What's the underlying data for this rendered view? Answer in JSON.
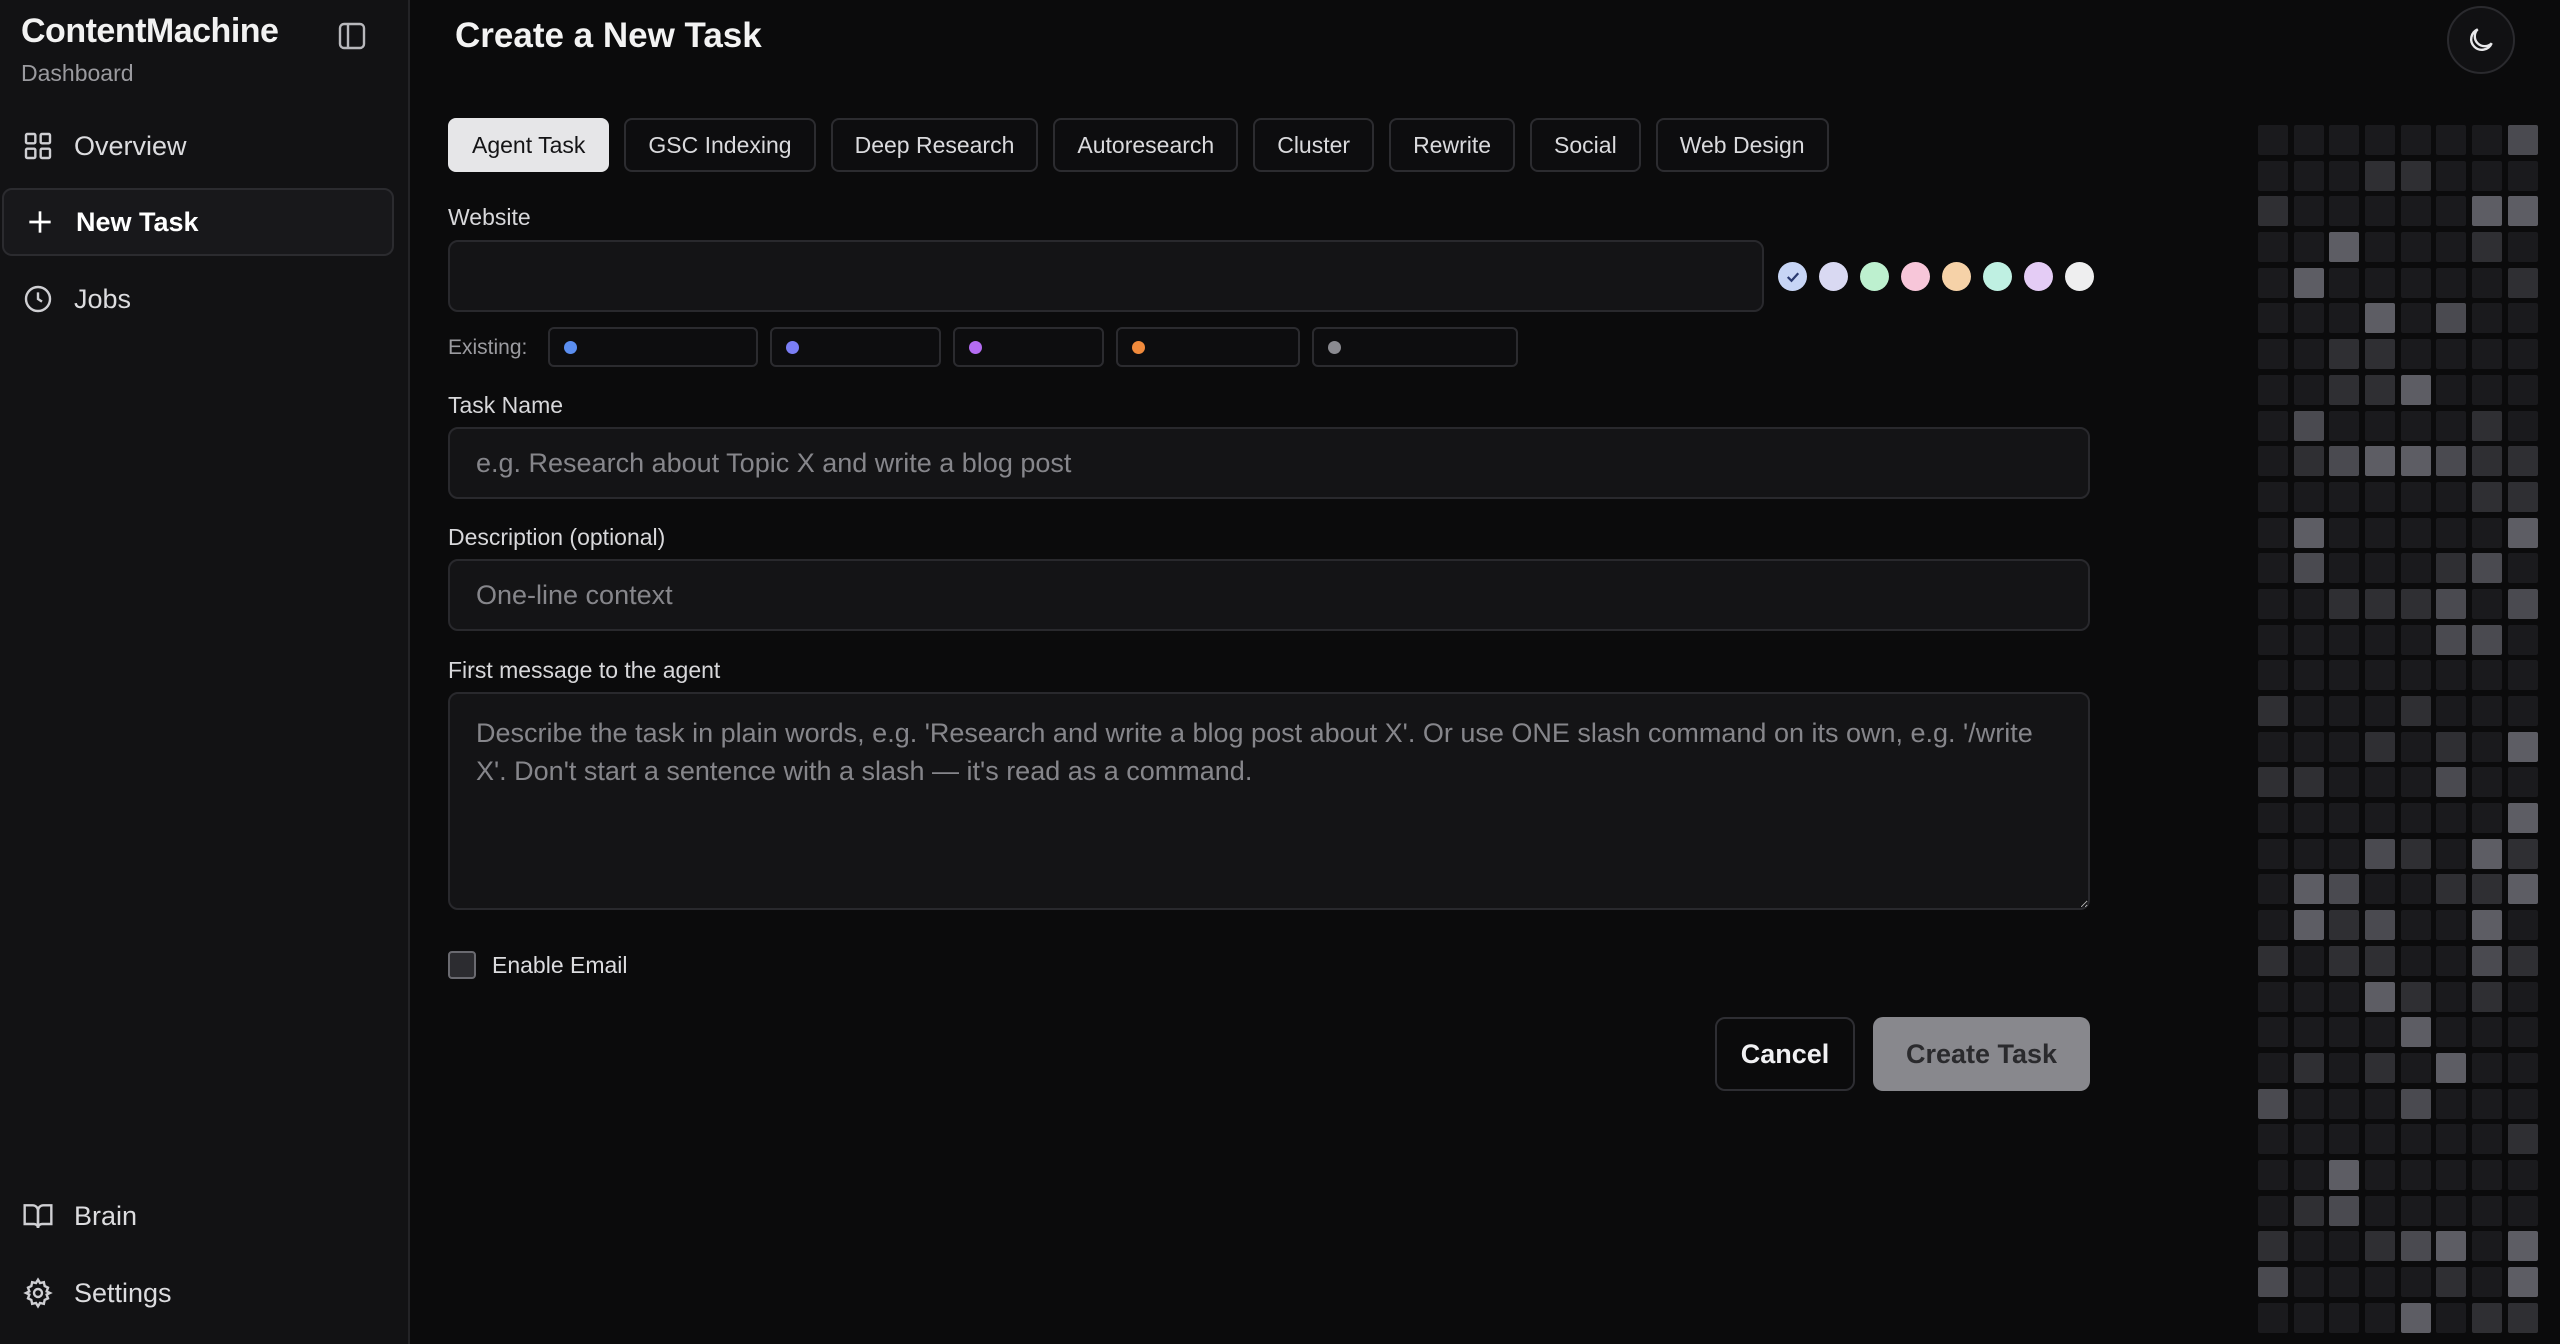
{
  "sidebar": {
    "brand": "ContentMachine",
    "subtitle": "Dashboard",
    "items": [
      {
        "label": "Overview",
        "icon": "grid-icon"
      },
      {
        "label": "New Task",
        "icon": "plus-icon"
      },
      {
        "label": "Jobs",
        "icon": "clock-icon"
      }
    ],
    "bottom_items": [
      {
        "label": "Brain",
        "icon": "book-icon"
      },
      {
        "label": "Settings",
        "icon": "gear-icon"
      }
    ]
  },
  "header": {
    "title": "Create a New Task"
  },
  "tabs": [
    "Agent Task",
    "GSC Indexing",
    "Deep Research",
    "Autoresearch",
    "Cluster",
    "Rewrite",
    "Social",
    "Web Design"
  ],
  "active_tab": "Agent Task",
  "form": {
    "website_label": "Website",
    "website_value": "",
    "existing_label": "Existing:",
    "swatch_colors": [
      "#c7d5f5",
      "#d9d9f2",
      "#bdf0cf",
      "#f7c6d9",
      "#f6d2a8",
      "#bff0e2",
      "#e4ccf5",
      "#eeeeef"
    ],
    "existing_chip_dots": [
      "#5b8ef0",
      "#7b7ef5",
      "#b46cf2",
      "#f08a3c",
      "#8a8a90"
    ],
    "task_name_label": "Task Name",
    "task_name_placeholder": "e.g. Research about Topic X and write a blog post",
    "description_label": "Description (optional)",
    "description_placeholder": "One-line context",
    "first_message_label": "First message to the agent",
    "first_message_placeholder": "Describe the task in plain words, e.g. 'Research and write a blog post about X'. Or use ONE slash command on its own, e.g. '/write X'. Don't start a sentence with a slash — it's read as a command.",
    "enable_email_label": "Enable Email",
    "enable_email_checked": false
  },
  "actions": {
    "cancel": "Cancel",
    "create": "Create Task"
  }
}
